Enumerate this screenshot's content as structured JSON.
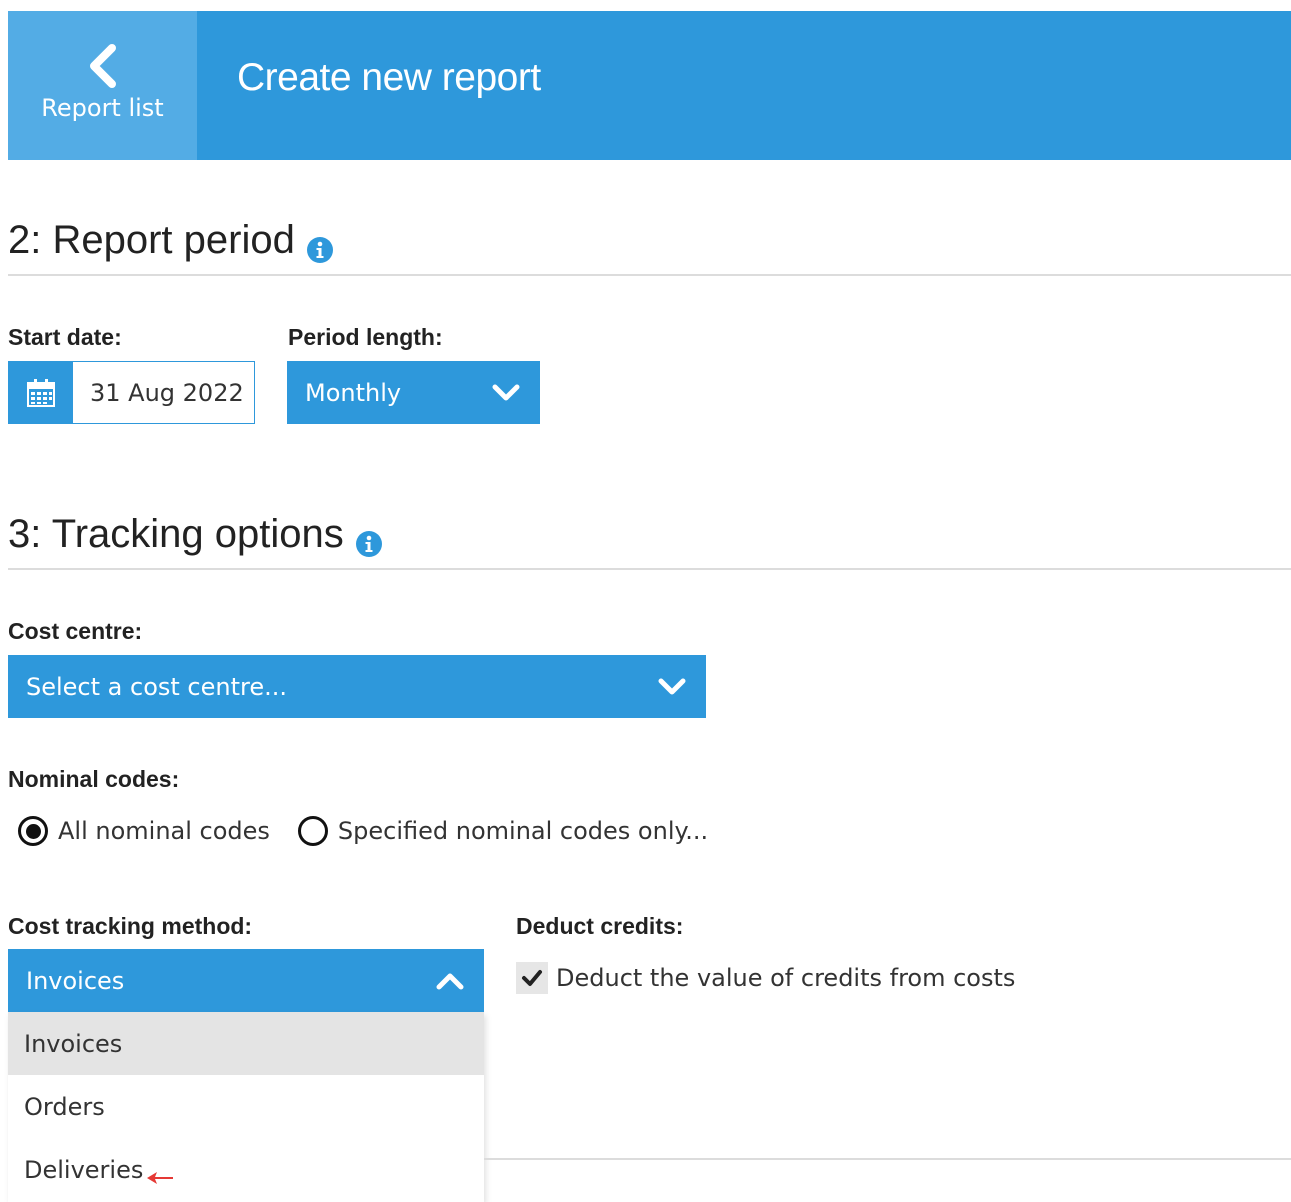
{
  "header": {
    "back_label": "Report list",
    "title": "Create new report",
    "color": "#2e98db",
    "back_color": "#53ace5"
  },
  "period": {
    "heading": "2: Report period",
    "start_label": "Start date:",
    "start_value": "31 Aug 2022",
    "length_label": "Period length:",
    "length_value": "Monthly"
  },
  "tracking": {
    "heading": "3: Tracking options",
    "cost_centre_label": "Cost centre:",
    "cost_centre_value": "Select a cost centre...",
    "nominal_label": "Nominal codes:",
    "nominal_options": [
      {
        "label": "All nominal codes",
        "selected": true
      },
      {
        "label": "Specified nominal codes only...",
        "selected": false
      }
    ],
    "method_label": "Cost tracking method:",
    "method_value": "Invoices",
    "method_options": [
      "Invoices",
      "Orders",
      "Deliveries"
    ],
    "deduct_label": "Deduct credits:",
    "deduct_text": "Deduct the value of credits from costs",
    "deduct_checked": true
  },
  "icons": {
    "back": "chevron-left-icon",
    "info": "info-icon",
    "calendar": "calendar-icon",
    "caret_down": "chevron-down-icon",
    "caret_up": "chevron-up-icon",
    "check": "check-icon",
    "pointer": "arrow-left-icon"
  },
  "accent_color": "#2e98db"
}
